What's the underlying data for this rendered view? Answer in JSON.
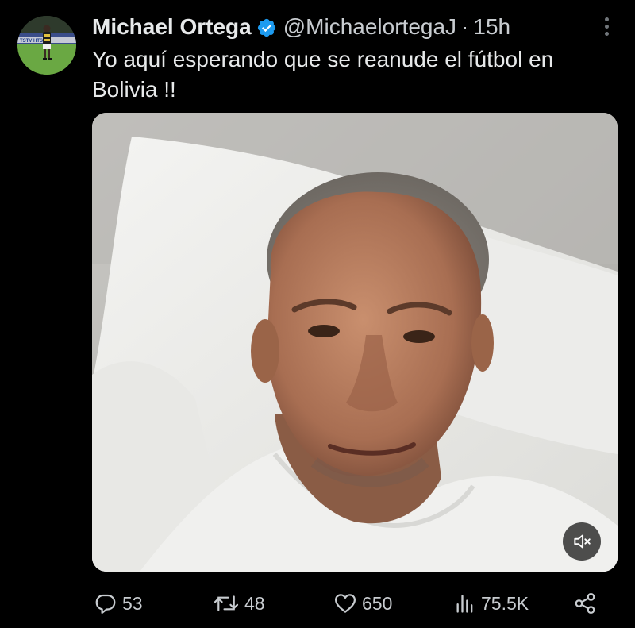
{
  "post": {
    "author": {
      "display_name": "Michael Ortega",
      "handle": "@MichaelortegaJ",
      "verified": true
    },
    "separator": "·",
    "timestamp": "15h",
    "text": "Yo aquí esperando que se reanude el fútbol en Bolivia !!",
    "avatar_logo_text": "TSTV HTS",
    "media": {
      "type": "video",
      "muted": true
    }
  },
  "actions": {
    "replies": "53",
    "reposts": "48",
    "likes": "650",
    "views": "75.5K"
  },
  "icons": {
    "verified": "verified-badge-icon",
    "more": "more-options-icon",
    "reply": "reply-icon",
    "repost": "repost-icon",
    "like": "heart-icon",
    "views": "views-icon",
    "share": "share-icon",
    "mute": "muted-speaker-icon"
  },
  "colors": {
    "background": "#000000",
    "text_primary": "#e7e9ea",
    "text_secondary": "#c8ccd0",
    "verified_blue": "#1d9bf0"
  }
}
